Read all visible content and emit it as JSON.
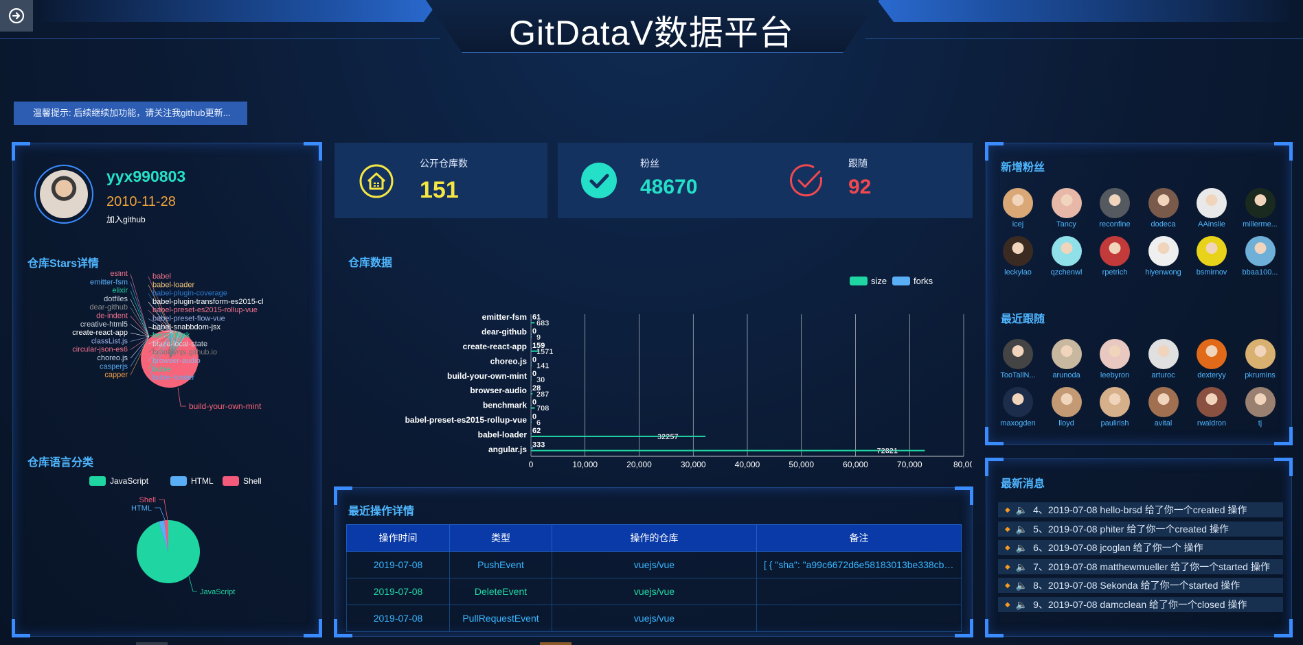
{
  "header": {
    "title": "GitDataV数据平台"
  },
  "notice": "温馨提示: 后续继续加功能，请关注我github更新...",
  "profile": {
    "username": "yyx990803",
    "join_date": "2010-11-28",
    "join_label": "加入github"
  },
  "sections": {
    "stars": "仓库Stars详情",
    "languages": "仓库语言分类",
    "repo_data": "仓库数据",
    "recent_ops": "最近操作详情",
    "new_followers": "新增粉丝",
    "recent_following": "最近跟随",
    "latest_messages": "最新消息"
  },
  "stats": {
    "repos": {
      "label": "公开仓库数",
      "value": "151",
      "color": "#f5e642"
    },
    "followers": {
      "label": "粉丝",
      "value": "48670",
      "color": "#25e0c8"
    },
    "following": {
      "label": "跟随",
      "value": "92",
      "color": "#f2484f"
    }
  },
  "chart_data": [
    {
      "type": "pie",
      "title": "仓库Stars详情",
      "labels_left": [
        "eslint",
        "emitter-fsm",
        "elixir",
        "dotfiles",
        "dear-github",
        "de-indent",
        "creative-html5",
        "create-react-app",
        "classList.js",
        "circular-json-es6",
        "choreo.js",
        "casperjs",
        "capper"
      ],
      "labels_right": [
        "babel",
        "babel-loader",
        "babel-plugin-coverage",
        "babel-plugin-transform-es2015-cl",
        "babel-preset-es2015-rollup-vue",
        "babel-preset-flow-vue",
        "babel-snabbdom-jsx",
        "benchmark",
        "blaze-local-state",
        "brooklynjs.github.io",
        "browser-audio",
        "buble",
        "buble-loader"
      ],
      "dominant_label": "build-your-own-mint"
    },
    {
      "type": "pie",
      "title": "仓库语言分类",
      "series": [
        {
          "name": "JavaScript",
          "value": 95,
          "color": "#1fd6a3"
        },
        {
          "name": "HTML",
          "value": 3,
          "color": "#5aaef5"
        },
        {
          "name": "Shell",
          "value": 2,
          "color": "#f45b7a"
        }
      ]
    },
    {
      "type": "bar",
      "title": "仓库数据",
      "orientation": "horizontal",
      "series_names": [
        "size",
        "forks"
      ],
      "series_colors": [
        "#1fd6a3",
        "#5aaef5"
      ],
      "category_labels": [
        "angular.js",
        "babel-loader",
        "babel-preset-es2015-rollup-vue",
        "benchmark",
        "browser-audio",
        "build-your-own-mint",
        "choreo.js",
        "create-react-app",
        "dear-github",
        "emitter-fsm"
      ],
      "bars": [
        {
          "size": 72821,
          "forks": 333
        },
        {
          "size": 32257,
          "forks": 62
        },
        {
          "size": 6,
          "forks": 0
        },
        {
          "size": 708,
          "forks": 0
        },
        {
          "size": 287,
          "forks": 28
        },
        {
          "size": 30,
          "forks": 0
        },
        {
          "size": 141,
          "forks": 0
        },
        {
          "size": 1571,
          "forks": 159
        },
        {
          "size": 9,
          "forks": 0
        },
        {
          "size": 683,
          "forks": 61
        }
      ],
      "xlim": [
        0,
        80000
      ],
      "xticks": [
        "0",
        "10,000",
        "20,000",
        "30,000",
        "40,000",
        "50,000",
        "60,000",
        "70,000",
        "80,00"
      ]
    }
  ],
  "table": {
    "headers": [
      "操作时间",
      "类型",
      "操作的仓库",
      "备注"
    ],
    "rows": [
      [
        "2019-07-08",
        "PushEvent",
        "vuejs/vue",
        "[ { \"sha\": \"a99c6672d6e58183013be338cb…"
      ],
      [
        "2019-07-08",
        "DeleteEvent",
        "vuejs/vue",
        ""
      ],
      [
        "2019-07-08",
        "PullRequestEvent",
        "vuejs/vue",
        ""
      ]
    ]
  },
  "new_followers": [
    {
      "name": "icej",
      "color": "#d9a876"
    },
    {
      "name": "Tancy",
      "color": "#e7b8a8"
    },
    {
      "name": "reconfine",
      "color": "#555a60"
    },
    {
      "name": "dodeca",
      "color": "#7a5a4a"
    },
    {
      "name": "AAinslie",
      "color": "#e9e9e9"
    },
    {
      "name": "millerme...",
      "color": "#1b2a1e"
    },
    {
      "name": "leckylao",
      "color": "#3a2a22"
    },
    {
      "name": "qzchenwl",
      "color": "#8fe0e8"
    },
    {
      "name": "rpetrich",
      "color": "#c23a3a"
    },
    {
      "name": "hiyenwong",
      "color": "#efefef"
    },
    {
      "name": "bsmirnov",
      "color": "#e8d21a"
    },
    {
      "name": "bbaa100...",
      "color": "#6fb0d8"
    }
  ],
  "following": [
    {
      "name": "TooTallN...",
      "color": "#444444"
    },
    {
      "name": "arunoda",
      "color": "#c8b8a0"
    },
    {
      "name": "leebyron",
      "color": "#e8c8c0"
    },
    {
      "name": "arturoc",
      "color": "#e0e0e0"
    },
    {
      "name": "dexteryy",
      "color": "#e06a1a"
    },
    {
      "name": "pkrumins",
      "color": "#d8b070"
    },
    {
      "name": "maxogden",
      "color": "#1b2d4a"
    },
    {
      "name": "lloyd",
      "color": "#c49a74"
    },
    {
      "name": "paulirish",
      "color": "#d6b08a"
    },
    {
      "name": "avital",
      "color": "#a07050"
    },
    {
      "name": "rwaldron",
      "color": "#8a5040"
    },
    {
      "name": "tj",
      "color": "#9a8070"
    }
  ],
  "messages": [
    "4、2019-07-08   hello-brsd 给了你一个created 操作",
    "5、2019-07-08   phiter 给了你一个created 操作",
    "6、2019-07-08   jcoglan 给了你一个 操作",
    "7、2019-07-08   matthewmueller 给了你一个started 操作",
    "8、2019-07-08   Sekonda 给了你一个started 操作",
    "9、2019-07-08   damcclean 给了你一个closed 操作"
  ]
}
